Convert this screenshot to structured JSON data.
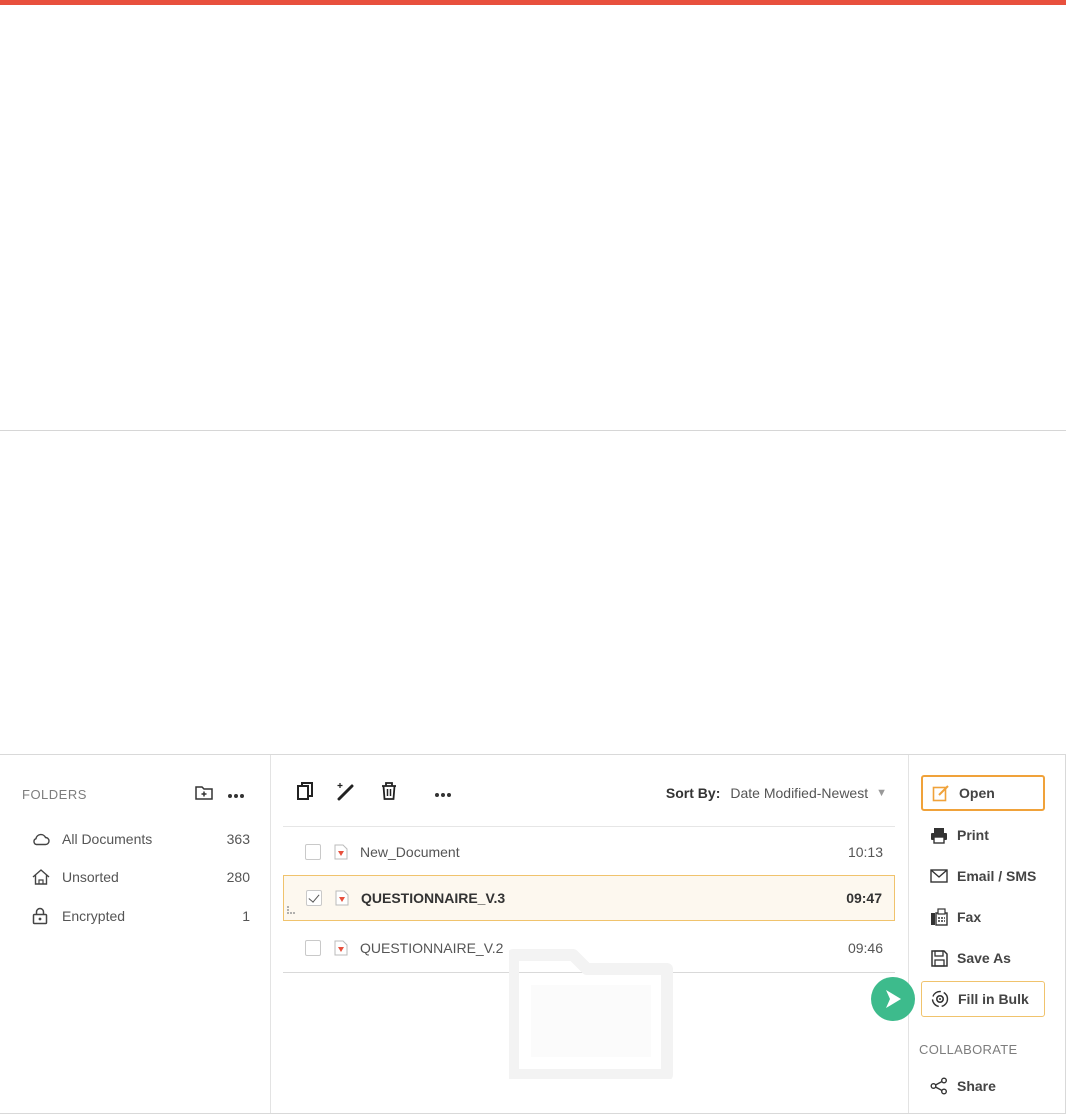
{
  "colors": {
    "accent": "#e8503d",
    "highlight": "#f0a23a",
    "pointer": "#3dbb8c"
  },
  "folders": {
    "title": "FOLDERS",
    "items": [
      {
        "label": "All Documents",
        "count": "363",
        "icon": "cloud-icon"
      },
      {
        "label": "Unsorted",
        "count": "280",
        "icon": "home-icon"
      },
      {
        "label": "Encrypted",
        "count": "1",
        "icon": "lock-icon"
      }
    ]
  },
  "toolbar": {
    "sort_label": "Sort By:",
    "sort_value": "Date Modified-Newest"
  },
  "files": [
    {
      "name": "New_Document",
      "time": "10:13",
      "checked": false
    },
    {
      "name": "QUESTIONNAIRE_V.3",
      "time": "09:47",
      "checked": true
    },
    {
      "name": "QUESTIONNAIRE_V.2",
      "time": "09:46",
      "checked": false
    }
  ],
  "actions": {
    "open": "Open",
    "print": "Print",
    "email": "Email / SMS",
    "fax": "Fax",
    "save_as": "Save As",
    "fill_in_bulk": "Fill in Bulk",
    "collaborate_heading": "COLLABORATE",
    "share": "Share"
  }
}
